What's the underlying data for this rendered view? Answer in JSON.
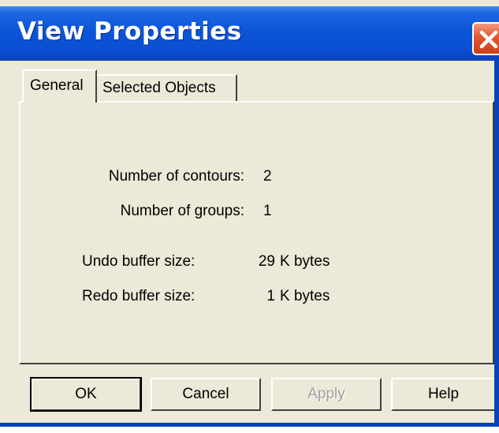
{
  "window": {
    "title": "View Properties"
  },
  "tabs": [
    {
      "label": "General",
      "active": true
    },
    {
      "label": "Selected Objects",
      "active": false
    }
  ],
  "general": {
    "contours_label": "Number of contours:",
    "contours_value": "2",
    "groups_label": "Number of groups:",
    "groups_value": "1",
    "undo_label": "Undo buffer size:",
    "undo_value": "29",
    "undo_unit": "K bytes",
    "redo_label": "Redo buffer size:",
    "redo_value": "1",
    "redo_unit": "K bytes"
  },
  "buttons": {
    "ok": "OK",
    "cancel": "Cancel",
    "apply": "Apply",
    "help": "Help"
  },
  "colors": {
    "titlebar": "#0a4fd2",
    "dialog_face": "#ece9d8",
    "close_button": "#e4562f",
    "disabled_text": "#a0a0a0"
  },
  "icons": {
    "close": "close-icon"
  }
}
